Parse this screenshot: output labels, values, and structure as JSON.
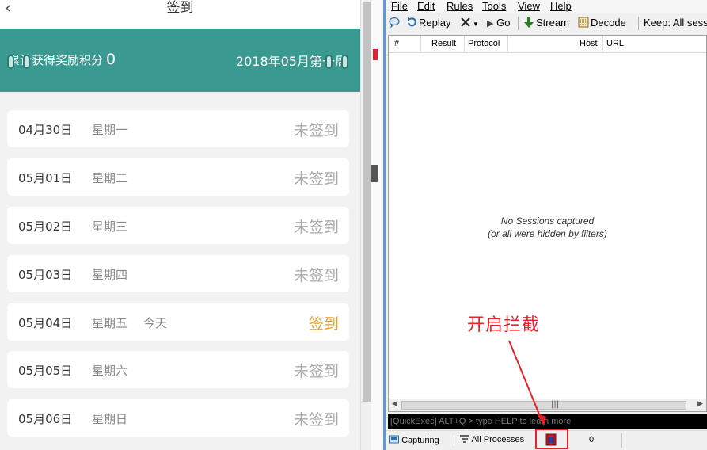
{
  "signin": {
    "back_glyph": "‹",
    "title": "签到",
    "points_label": "累计获得奖励积分",
    "points_value": "0",
    "week_label": "2018年05月第一周",
    "colors": {
      "banner": "#3a9990",
      "signed_action": "#f0a020",
      "unsigned": "#aaaaaa"
    },
    "days": [
      {
        "date": "04月30日",
        "weekday": "星期一",
        "extra": "",
        "status": "未签到"
      },
      {
        "date": "05月01日",
        "weekday": "星期二",
        "extra": "",
        "status": "未签到"
      },
      {
        "date": "05月02日",
        "weekday": "星期三",
        "extra": "",
        "status": "未签到"
      },
      {
        "date": "05月03日",
        "weekday": "星期四",
        "extra": "",
        "status": "未签到"
      },
      {
        "date": "05月04日",
        "weekday": "星期五",
        "extra": "今天",
        "status": "签到"
      },
      {
        "date": "05月05日",
        "weekday": "星期六",
        "extra": "",
        "status": "未签到"
      },
      {
        "date": "05月06日",
        "weekday": "星期日",
        "extra": "",
        "status": "未签到"
      }
    ]
  },
  "fiddler": {
    "menu": [
      "File",
      "Edit",
      "Rules",
      "Tools",
      "View",
      "Help"
    ],
    "toolbar": {
      "replay": "Replay",
      "go": "Go",
      "stream": "Stream",
      "decode": "Decode",
      "keep": "Keep: All sess"
    },
    "columns": [
      "#",
      "Result",
      "Protocol",
      "Host",
      "URL"
    ],
    "empty_line1": "No Sessions captured",
    "empty_line2": "(or all were hidden by filters)",
    "quickexec": "[QuickExec] ALT+Q > type HELP to learn more",
    "status": {
      "capturing": "Capturing",
      "processes": "All Processes",
      "count": "0"
    }
  },
  "annotation": {
    "text": "开启拦截",
    "color": "#e8202a"
  }
}
